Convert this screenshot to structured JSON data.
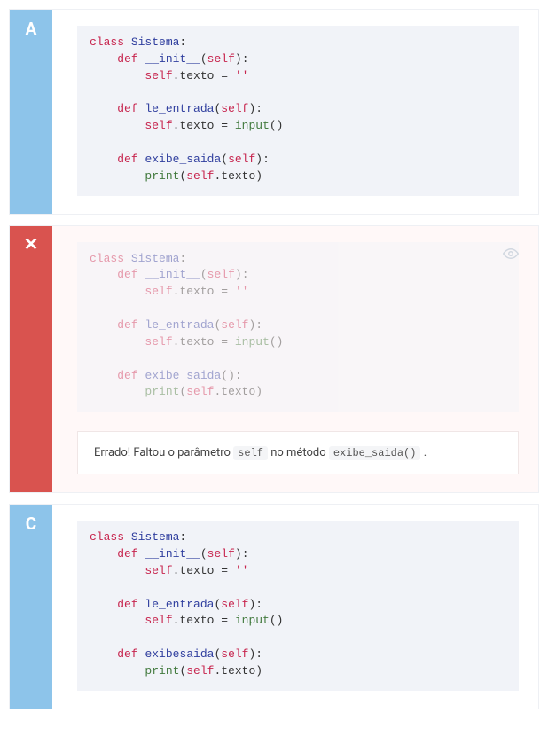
{
  "options": [
    {
      "letter": "A",
      "status": "neutral",
      "code_tokens": [
        [
          {
            "t": "class ",
            "c": "kw"
          },
          {
            "t": "Sistema",
            "c": "cls"
          },
          {
            "t": ":",
            "c": ""
          }
        ],
        [
          {
            "t": "    ",
            "c": ""
          },
          {
            "t": "def ",
            "c": "kw"
          },
          {
            "t": "__init__",
            "c": "dund"
          },
          {
            "t": "(",
            "c": ""
          },
          {
            "t": "self",
            "c": "self"
          },
          {
            "t": "):",
            "c": ""
          }
        ],
        [
          {
            "t": "        ",
            "c": ""
          },
          {
            "t": "self",
            "c": "self"
          },
          {
            "t": ".texto = ",
            "c": ""
          },
          {
            "t": "''",
            "c": "str"
          }
        ],
        [
          {
            "t": "",
            "c": ""
          }
        ],
        [
          {
            "t": "    ",
            "c": ""
          },
          {
            "t": "def ",
            "c": "kw"
          },
          {
            "t": "le_entrada",
            "c": "fn"
          },
          {
            "t": "(",
            "c": ""
          },
          {
            "t": "self",
            "c": "self"
          },
          {
            "t": "):",
            "c": ""
          }
        ],
        [
          {
            "t": "        ",
            "c": ""
          },
          {
            "t": "self",
            "c": "self"
          },
          {
            "t": ".texto = ",
            "c": ""
          },
          {
            "t": "input",
            "c": "builtin"
          },
          {
            "t": "()",
            "c": ""
          }
        ],
        [
          {
            "t": "",
            "c": ""
          }
        ],
        [
          {
            "t": "    ",
            "c": ""
          },
          {
            "t": "def ",
            "c": "kw"
          },
          {
            "t": "exibe_saida",
            "c": "fn"
          },
          {
            "t": "(",
            "c": ""
          },
          {
            "t": "self",
            "c": "self"
          },
          {
            "t": "):",
            "c": ""
          }
        ],
        [
          {
            "t": "        ",
            "c": ""
          },
          {
            "t": "print",
            "c": "builtin"
          },
          {
            "t": "(",
            "c": ""
          },
          {
            "t": "self",
            "c": "self"
          },
          {
            "t": ".texto)",
            "c": ""
          }
        ]
      ]
    },
    {
      "letter": "X",
      "status": "wrong",
      "code_tokens": [
        [
          {
            "t": "class ",
            "c": "kw"
          },
          {
            "t": "Sistema",
            "c": "cls"
          },
          {
            "t": ":",
            "c": ""
          }
        ],
        [
          {
            "t": "    ",
            "c": ""
          },
          {
            "t": "def ",
            "c": "kw"
          },
          {
            "t": "__init__",
            "c": "dund"
          },
          {
            "t": "(",
            "c": ""
          },
          {
            "t": "self",
            "c": "self"
          },
          {
            "t": "):",
            "c": ""
          }
        ],
        [
          {
            "t": "        ",
            "c": ""
          },
          {
            "t": "self",
            "c": "self"
          },
          {
            "t": ".texto = ",
            "c": ""
          },
          {
            "t": "''",
            "c": "str"
          }
        ],
        [
          {
            "t": "",
            "c": ""
          }
        ],
        [
          {
            "t": "    ",
            "c": ""
          },
          {
            "t": "def ",
            "c": "kw"
          },
          {
            "t": "le_entrada",
            "c": "fn"
          },
          {
            "t": "(",
            "c": ""
          },
          {
            "t": "self",
            "c": "self"
          },
          {
            "t": "):",
            "c": ""
          }
        ],
        [
          {
            "t": "        ",
            "c": ""
          },
          {
            "t": "self",
            "c": "self"
          },
          {
            "t": ".texto = ",
            "c": ""
          },
          {
            "t": "input",
            "c": "builtin"
          },
          {
            "t": "()",
            "c": ""
          }
        ],
        [
          {
            "t": "",
            "c": ""
          }
        ],
        [
          {
            "t": "    ",
            "c": ""
          },
          {
            "t": "def ",
            "c": "kw"
          },
          {
            "t": "exibe_saida",
            "c": "fn"
          },
          {
            "t": "():",
            "c": ""
          }
        ],
        [
          {
            "t": "        ",
            "c": ""
          },
          {
            "t": "print",
            "c": "builtin"
          },
          {
            "t": "(",
            "c": ""
          },
          {
            "t": "self",
            "c": "self"
          },
          {
            "t": ".texto)",
            "c": ""
          }
        ]
      ],
      "feedback": {
        "prefix": "Errado! Faltou o parâmetro ",
        "code1": "self",
        "mid": " no método ",
        "code2": "exibe_saida()",
        "suffix": " ."
      }
    },
    {
      "letter": "C",
      "status": "neutral",
      "code_tokens": [
        [
          {
            "t": "class ",
            "c": "kw"
          },
          {
            "t": "Sistema",
            "c": "cls"
          },
          {
            "t": ":",
            "c": ""
          }
        ],
        [
          {
            "t": "    ",
            "c": ""
          },
          {
            "t": "def ",
            "c": "kw"
          },
          {
            "t": "__init__",
            "c": "dund"
          },
          {
            "t": "(",
            "c": ""
          },
          {
            "t": "self",
            "c": "self"
          },
          {
            "t": "):",
            "c": ""
          }
        ],
        [
          {
            "t": "        ",
            "c": ""
          },
          {
            "t": "self",
            "c": "self"
          },
          {
            "t": ".texto = ",
            "c": ""
          },
          {
            "t": "''",
            "c": "str"
          }
        ],
        [
          {
            "t": "",
            "c": ""
          }
        ],
        [
          {
            "t": "    ",
            "c": ""
          },
          {
            "t": "def ",
            "c": "kw"
          },
          {
            "t": "le_entrada",
            "c": "fn"
          },
          {
            "t": "(",
            "c": ""
          },
          {
            "t": "self",
            "c": "self"
          },
          {
            "t": "):",
            "c": ""
          }
        ],
        [
          {
            "t": "        ",
            "c": ""
          },
          {
            "t": "self",
            "c": "self"
          },
          {
            "t": ".texto = ",
            "c": ""
          },
          {
            "t": "input",
            "c": "builtin"
          },
          {
            "t": "()",
            "c": ""
          }
        ],
        [
          {
            "t": "",
            "c": ""
          }
        ],
        [
          {
            "t": "    ",
            "c": ""
          },
          {
            "t": "def ",
            "c": "kw"
          },
          {
            "t": "exibesaida",
            "c": "fn"
          },
          {
            "t": "(",
            "c": ""
          },
          {
            "t": "self",
            "c": "self"
          },
          {
            "t": "):",
            "c": ""
          }
        ],
        [
          {
            "t": "        ",
            "c": ""
          },
          {
            "t": "print",
            "c": "builtin"
          },
          {
            "t": "(",
            "c": ""
          },
          {
            "t": "self",
            "c": "self"
          },
          {
            "t": ".texto)",
            "c": ""
          }
        ]
      ]
    }
  ]
}
